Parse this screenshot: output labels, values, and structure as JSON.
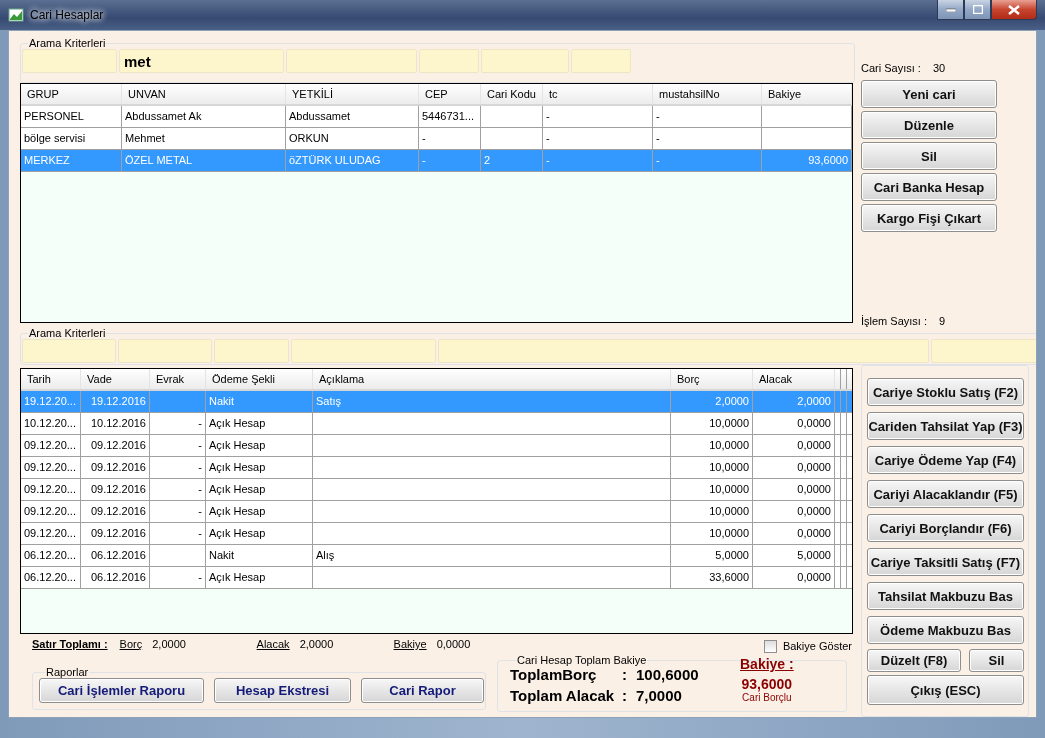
{
  "window": {
    "title": "Cari Hesaplar"
  },
  "accounts_search": {
    "label": "Arama Kriterleri",
    "query": "met"
  },
  "cari_count": {
    "label": "Cari Sayısı :",
    "value": "30"
  },
  "accounts_table": {
    "columns": [
      "GRUP",
      "UNVAN",
      "YETKİLİ",
      "CEP",
      "Cari Kodu",
      "tc",
      "mustahsilNo",
      "Bakiye"
    ],
    "rows": [
      {
        "selected": false,
        "cells": [
          "PERSONEL",
          "Abdussamet Ak",
          "Abdussamet",
          "5446731...",
          null,
          "-",
          "-",
          null
        ]
      },
      {
        "selected": false,
        "cells": [
          "bölge servisi",
          "Mehmet",
          "ORKUN",
          "-",
          null,
          "-",
          "-",
          null
        ]
      },
      {
        "selected": true,
        "cells": [
          "MERKEZ",
          "ÖZEL METAL",
          "öZTÜRK ULUDAG",
          "-",
          "2",
          "-",
          "-",
          "93,6000"
        ]
      }
    ]
  },
  "account_buttons": [
    "Yeni cari",
    "Düzenle",
    "Sil",
    "Cari Banka Hesap",
    "Kargo Fişi Çıkart"
  ],
  "transaction_count": {
    "label": "İşlem Sayısı :",
    "value": "9"
  },
  "transactions_search": {
    "label": "Arama Kriterleri"
  },
  "transactions_table": {
    "columns": [
      "Tarih",
      "Vade",
      "Evrak",
      "Ödeme Şekli",
      "Açıklama",
      "Borç",
      "Alacak"
    ],
    "rows": [
      {
        "selected": true,
        "cells": [
          "19.12.20...",
          "19.12.2016",
          null,
          "Nakit",
          "Satış",
          "2,0000",
          "2,0000"
        ]
      },
      {
        "selected": false,
        "cells": [
          "10.12.20...",
          "10.12.2016",
          "-",
          "Açık Hesap",
          null,
          "10,0000",
          "0,0000"
        ]
      },
      {
        "selected": false,
        "cells": [
          "09.12.20...",
          "09.12.2016",
          "-",
          "Açık Hesap",
          null,
          "10,0000",
          "0,0000"
        ]
      },
      {
        "selected": false,
        "cells": [
          "09.12.20...",
          "09.12.2016",
          "-",
          "Açık Hesap",
          null,
          "10,0000",
          "0,0000"
        ]
      },
      {
        "selected": false,
        "cells": [
          "09.12.20...",
          "09.12.2016",
          "-",
          "Açık Hesap",
          null,
          "10,0000",
          "0,0000"
        ]
      },
      {
        "selected": false,
        "cells": [
          "09.12.20...",
          "09.12.2016",
          "-",
          "Açık Hesap",
          null,
          "10,0000",
          "0,0000"
        ]
      },
      {
        "selected": false,
        "cells": [
          "09.12.20...",
          "09.12.2016",
          "-",
          "Açık Hesap",
          null,
          "10,0000",
          "0,0000"
        ]
      },
      {
        "selected": false,
        "cells": [
          "06.12.20...",
          "06.12.2016",
          null,
          "Nakit",
          "Alış",
          "5,0000",
          "5,0000"
        ]
      },
      {
        "selected": false,
        "cells": [
          "06.12.20...",
          "06.12.2016",
          "-",
          "Açık Hesap",
          null,
          "33,6000",
          "0,0000"
        ]
      }
    ]
  },
  "action_buttons": [
    "Cariye Stoklu Satış (F2)",
    "Cariden Tahsilat Yap (F3)",
    "Cariye Ödeme Yap (F4)",
    "Cariyi Alacaklandır (F5)",
    "Cariyi Borçlandır (F6)",
    "Cariye Taksitli Satış (F7)",
    "Tahsilat Makbuzu Bas",
    "Ödeme Makbuzu Bas"
  ],
  "row_buttons": [
    "Düzelt (F8)",
    "Sil"
  ],
  "exit_button": "Çıkış (ESC)",
  "row_totals": {
    "label": "Satır Toplamı :",
    "items": [
      {
        "label": "Borç",
        "value": "2,0000"
      },
      {
        "label": "Alacak",
        "value": "2,0000"
      },
      {
        "label": "Bakiye",
        "value": "0,0000"
      }
    ]
  },
  "show_balance": {
    "label": "Bakiye Göster",
    "checked": false
  },
  "reports": {
    "label": "Raporlar",
    "buttons": [
      "Cari İşlemler Raporu",
      "Hesap Ekstresi",
      "Cari Rapor"
    ]
  },
  "balance_summary": {
    "label": "Cari Hesap Toplam Bakiye",
    "lines": [
      {
        "label": "ToplamBorç",
        "separator": ":",
        "value": "100,6000"
      },
      {
        "label": "Toplam Alacak",
        "separator": ":",
        "value": "7,0000"
      }
    ],
    "balance_label": "Bakiye :",
    "balance": "93,6000",
    "status": "Cari Borçlu"
  }
}
